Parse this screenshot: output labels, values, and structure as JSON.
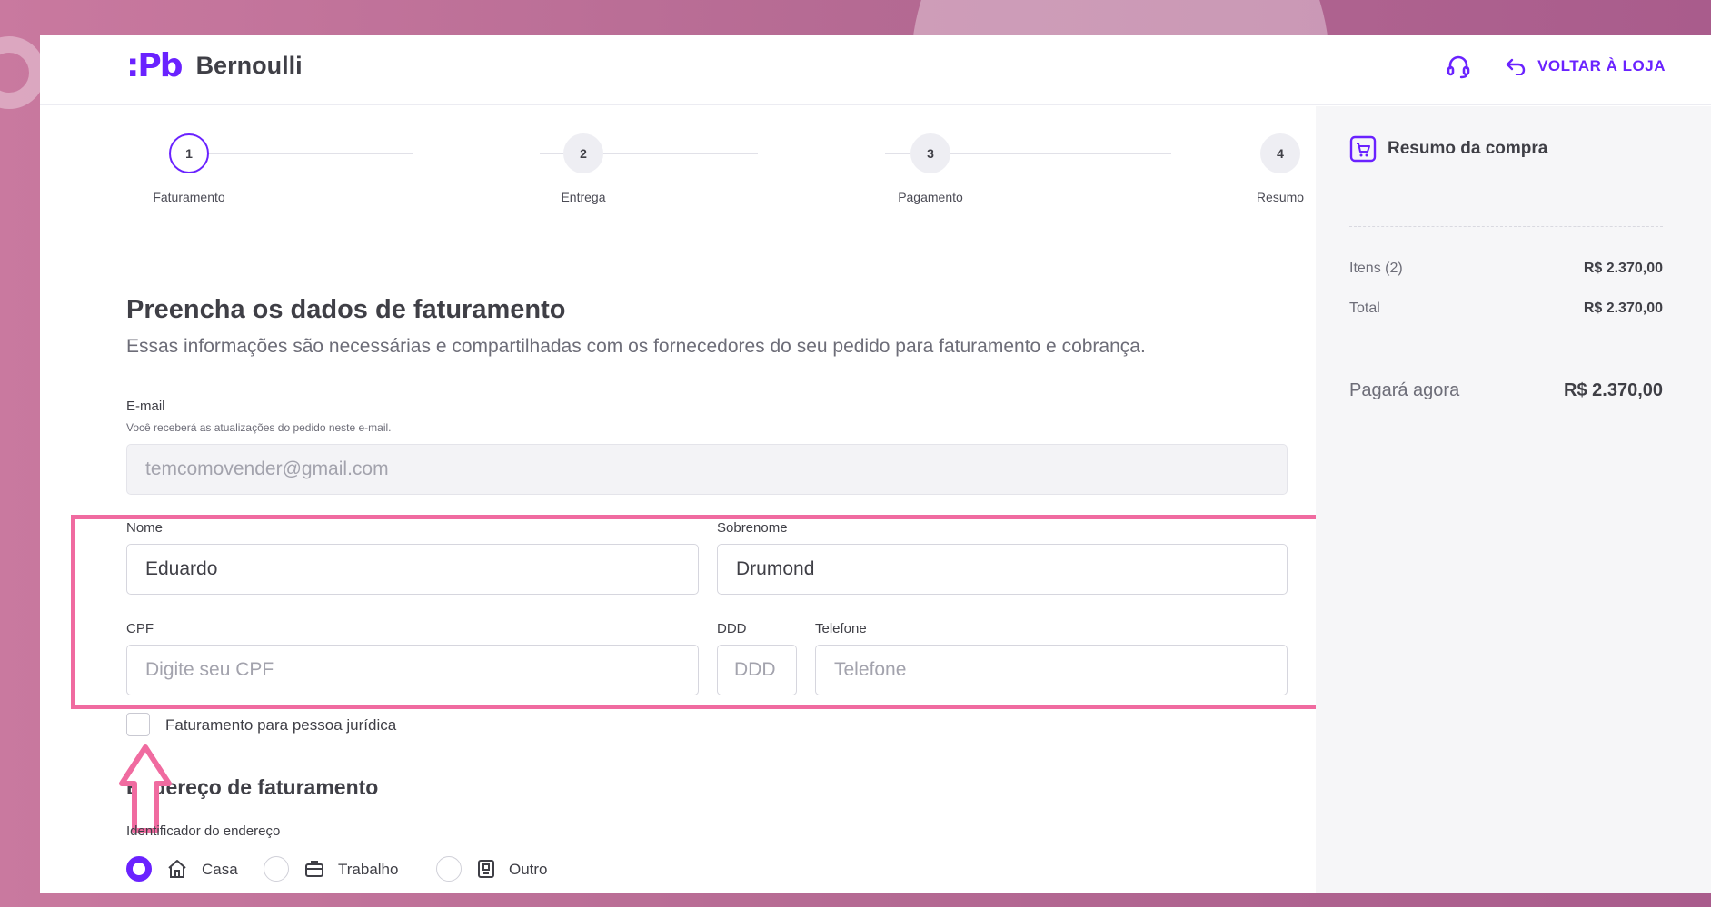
{
  "header": {
    "logo_mark": ":Pb",
    "brand": "Bernoulli",
    "back_label": "VOLTAR À LOJA"
  },
  "stepper": {
    "steps": [
      {
        "number": "1",
        "label": "Faturamento",
        "active": true
      },
      {
        "number": "2",
        "label": "Entrega",
        "active": false
      },
      {
        "number": "3",
        "label": "Pagamento",
        "active": false
      },
      {
        "number": "4",
        "label": "Resumo",
        "active": false
      }
    ]
  },
  "form": {
    "title": "Preencha os dados de faturamento",
    "subtitle": "Essas informações são necessárias e compartilhadas com os fornecedores do seu pedido para faturamento e cobrança.",
    "email_label": "E-mail",
    "email_hint": "Você receberá as atualizações do pedido neste e-mail.",
    "email_value": "temcomovender@gmail.com",
    "nome_label": "Nome",
    "nome_value": "Eduardo",
    "sobrenome_label": "Sobrenome",
    "sobrenome_value": "Drumond",
    "cpf_label": "CPF",
    "cpf_placeholder": "Digite seu CPF",
    "ddd_label": "DDD",
    "ddd_placeholder": "DDD",
    "telefone_label": "Telefone",
    "telefone_placeholder": "Telefone",
    "pj_checkbox_label": "Faturamento para pessoa jurídica",
    "address_title": "Endereço de faturamento",
    "address_id_label": "Identificador do endereço",
    "address_options": [
      {
        "label": "Casa",
        "icon": "house-icon",
        "checked": true
      },
      {
        "label": "Trabalho",
        "icon": "briefcase-icon",
        "checked": false
      },
      {
        "label": "Outro",
        "icon": "building-icon",
        "checked": false
      }
    ]
  },
  "summary": {
    "title": "Resumo da compra",
    "items_label": "Itens (2)",
    "items_value": "R$ 2.370,00",
    "total_label": "Total",
    "total_value": "R$ 2.370,00",
    "pay_now_label": "Pagará agora",
    "pay_now_value": "R$ 2.370,00"
  },
  "colors": {
    "accent": "#6a22ff",
    "highlight": "#f06ba0",
    "background": "#b56a93"
  }
}
